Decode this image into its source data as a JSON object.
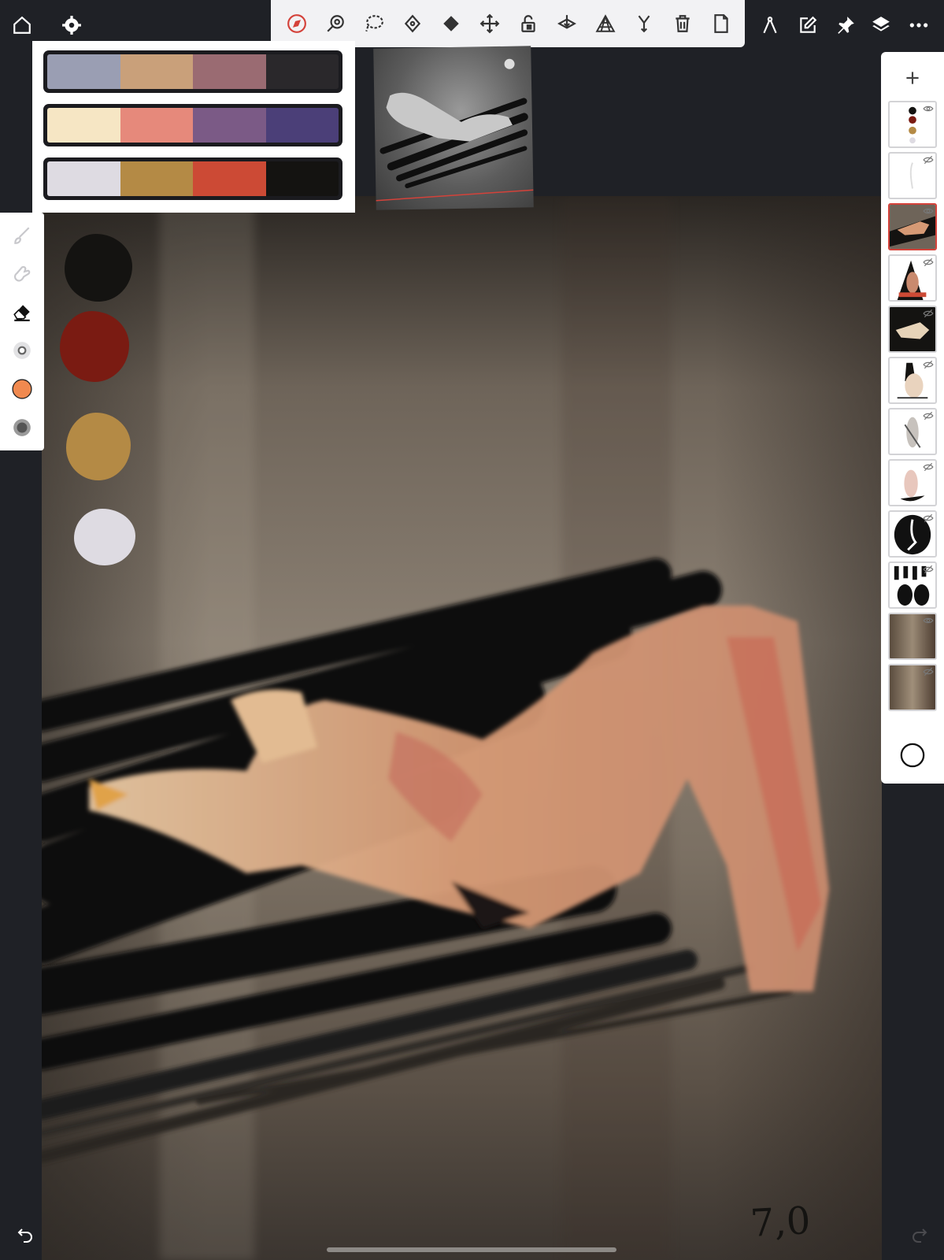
{
  "app": {
    "accent_color": "#d4423a",
    "top_left": {
      "home_icon": "home-icon",
      "settings_icon": "gear-icon"
    },
    "toolbar": {
      "tools": [
        {
          "name": "tool-navigate",
          "icon": "compass-icon",
          "active": true
        },
        {
          "name": "tool-zoom",
          "icon": "zoom-icon"
        },
        {
          "name": "tool-lasso",
          "icon": "lasso-icon"
        },
        {
          "name": "tool-pen",
          "icon": "pen-nib-icon"
        },
        {
          "name": "tool-fill",
          "icon": "fill-icon"
        },
        {
          "name": "tool-move",
          "icon": "move-icon"
        },
        {
          "name": "tool-lock",
          "icon": "lock-icon"
        },
        {
          "name": "tool-merge-down",
          "icon": "merge-down-icon"
        },
        {
          "name": "tool-perspective",
          "icon": "perspective-grid-icon"
        },
        {
          "name": "tool-merge",
          "icon": "merge-icon"
        },
        {
          "name": "tool-delete",
          "icon": "trash-icon"
        },
        {
          "name": "tool-document",
          "icon": "document-icon"
        }
      ]
    },
    "top_right": [
      "compass-ruler-icon",
      "edit-icon",
      "pin-icon",
      "layers-icon",
      "more-icon"
    ],
    "palettes": [
      [
        "#9a9eb3",
        "#c9a07a",
        "#9a6b72",
        "#2a282b"
      ],
      [
        "#f6e6c4",
        "#e6897b",
        "#7b5a86",
        "#4b3f78"
      ],
      [
        "#dedbe2",
        "#b48a45",
        "#cc4a35",
        "#141311"
      ]
    ],
    "left_tools": [
      "brush-icon",
      "smudge-icon",
      "eraser-icon",
      "brush-size-icon",
      "color-icon",
      "opacity-icon"
    ],
    "current_color": "#f0894f",
    "canvas_blobs": [
      "#141311",
      "#7a1b12",
      "#b48a45",
      "#dedbe2"
    ],
    "layers_panel": {
      "add_icon": "plus-icon",
      "selected_index": 2,
      "layer_count": 12,
      "blend_icon": "circle-icon"
    },
    "canvas_text": "7,0",
    "bottom": {
      "undo_icon": "undo-icon",
      "redo_icon": "redo-icon"
    }
  }
}
